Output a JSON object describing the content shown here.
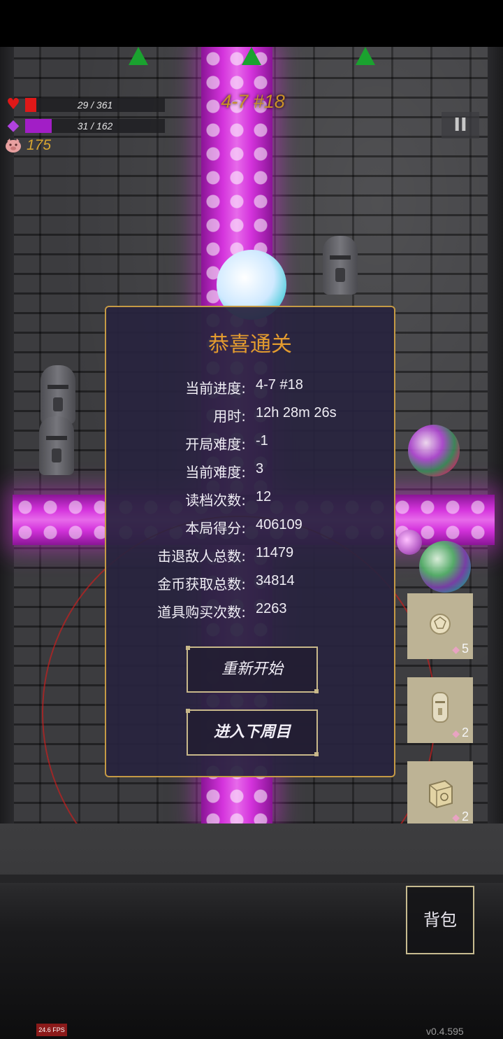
{
  "hud": {
    "hp": {
      "text": "29 / 361",
      "current": 29,
      "max": 361,
      "color": "#e01818"
    },
    "mana": {
      "text": "31 / 162",
      "current": 31,
      "max": 162,
      "color": "#a21ec6"
    },
    "coins": "175",
    "level": "4-7 #18",
    "pause_label": "II"
  },
  "panel": {
    "title": "恭喜通关",
    "stats": [
      {
        "label": "当前进度:",
        "value": "4-7 #18"
      },
      {
        "label": "用时:",
        "value": "12h 28m 26s"
      },
      {
        "label": "开局难度:",
        "value": "-1"
      },
      {
        "label": "当前难度:",
        "value": "3"
      },
      {
        "label": "读档次数:",
        "value": "12"
      },
      {
        "label": "本局得分:",
        "value": "406109"
      },
      {
        "label": "击退敌人总数:",
        "value": "11479"
      },
      {
        "label": "金币获取总数:",
        "value": "34814"
      },
      {
        "label": "道具购买次数:",
        "value": "2263"
      }
    ],
    "restart_label": "重新开始",
    "next_cycle_label": "进入下周目"
  },
  "items": [
    {
      "icon": "crystal-orb-icon",
      "count": "5"
    },
    {
      "icon": "statue-icon",
      "count": "2"
    },
    {
      "icon": "rune-cube-icon",
      "count": "2"
    }
  ],
  "bag_label": "背包",
  "fps": "24.6 FPS",
  "version": "v0.4.595",
  "colors": {
    "accent_gold": "#c59a45",
    "title_orange": "#e39b2f",
    "beam_magenta": "#d433dc"
  }
}
